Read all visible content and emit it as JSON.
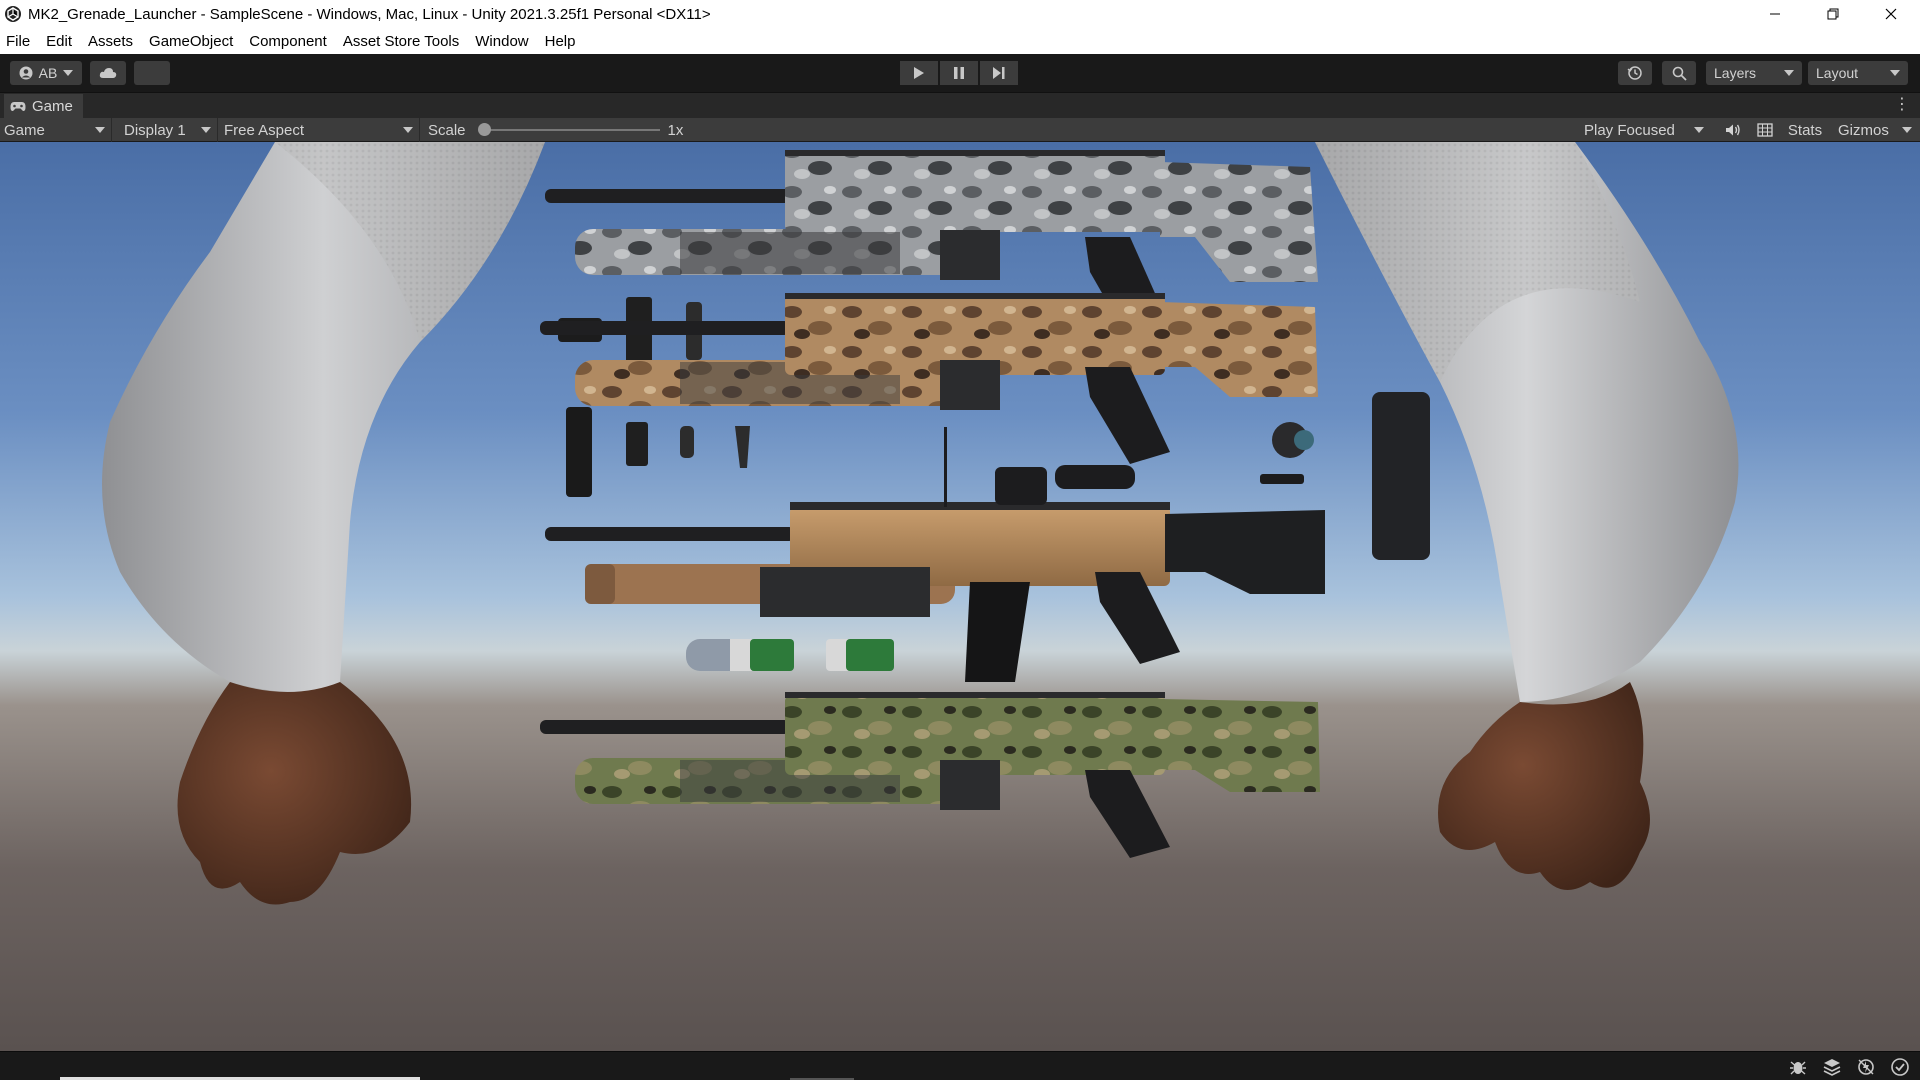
{
  "window": {
    "title": "MK2_Grenade_Launcher - SampleScene - Windows, Mac, Linux - Unity 2021.3.25f1 Personal <DX11>",
    "controls": [
      "minimize-icon",
      "restore-icon",
      "close-icon"
    ]
  },
  "menu": {
    "items": [
      "File",
      "Edit",
      "Assets",
      "GameObject",
      "Component",
      "Asset Store Tools",
      "Window",
      "Help"
    ]
  },
  "toolbar": {
    "account_label": "AB",
    "layers_label": "Layers",
    "layout_label": "Layout",
    "play_icons": [
      "play-icon",
      "pause-icon",
      "step-icon"
    ]
  },
  "tabs": {
    "game_label": "Game"
  },
  "gameview": {
    "mode": "Game",
    "display": "Display 1",
    "aspect": "Free Aspect",
    "scale_label": "Scale",
    "scale_value": "1x",
    "scale_fraction": 0.0,
    "play_mode": "Play Focused",
    "stats_label": "Stats",
    "gizmos_label": "Gizmos"
  },
  "scene": {
    "sky_top": "#4a6ea6",
    "ground": "#6c6360",
    "camo_variants": [
      "urban-gray",
      "desert-tan",
      "fde-tan",
      "woodland-green"
    ]
  },
  "statusbar": {
    "icons": [
      "bug-icon",
      "layers-stack-icon",
      "lighting-icon",
      "check-circle-icon"
    ]
  }
}
